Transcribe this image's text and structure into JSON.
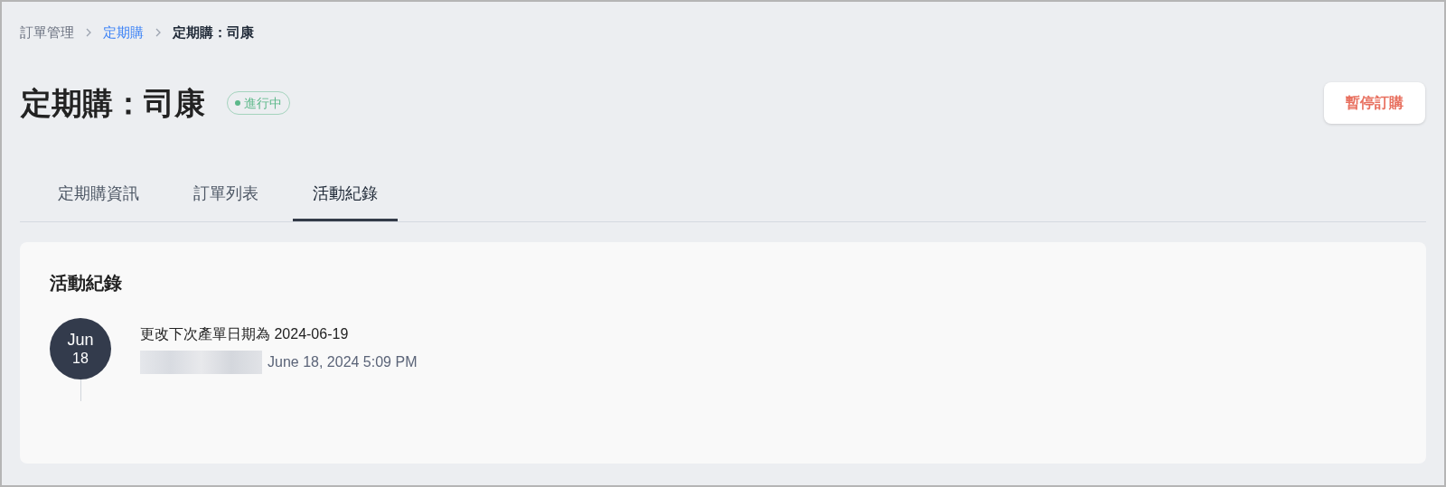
{
  "breadcrumb": [
    {
      "label": "訂單管理",
      "kind": "plain"
    },
    {
      "label": "定期購",
      "kind": "link"
    },
    {
      "label": "定期購：司康",
      "kind": "current"
    }
  ],
  "header": {
    "title": "定期購：司康",
    "status": {
      "label": "進行中",
      "color": "#5cb88a"
    },
    "action": "暫停訂購"
  },
  "tabs": [
    {
      "label": "定期購資訊",
      "selected": false
    },
    {
      "label": "訂單列表",
      "selected": false
    },
    {
      "label": "活動紀錄",
      "selected": true
    }
  ],
  "activity": {
    "title": "活動紀錄",
    "entries": [
      {
        "month": "Jun",
        "day": "18",
        "message": "更改下次產單日期為 2024-06-19",
        "redacted_user": true,
        "time": "June 18, 2024 5:09 PM"
      }
    ]
  }
}
